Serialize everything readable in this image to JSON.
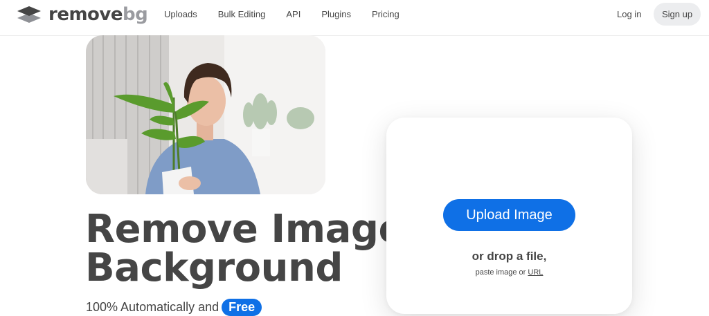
{
  "brand": {
    "name_main": "remove",
    "name_accent": "bg"
  },
  "nav": {
    "links": [
      {
        "label": "Uploads"
      },
      {
        "label": "Bulk Editing"
      },
      {
        "label": "API"
      },
      {
        "label": "Plugins"
      },
      {
        "label": "Pricing"
      }
    ],
    "login_label": "Log in",
    "signup_label": "Sign up"
  },
  "hero": {
    "headline_line1": "Remove Image",
    "headline_line2": "Background",
    "subline": "100% Automatically and",
    "free_badge": "Free"
  },
  "upload": {
    "button_label": "Upload Image",
    "drop_text": "or drop a file,",
    "paste_text": "paste image or",
    "url_link": "URL"
  },
  "colors": {
    "accent": "#0f70e6",
    "text": "#454545",
    "muted_logo": "#9a9ba0"
  },
  "icons": {
    "logo": "layers-logo-icon"
  }
}
